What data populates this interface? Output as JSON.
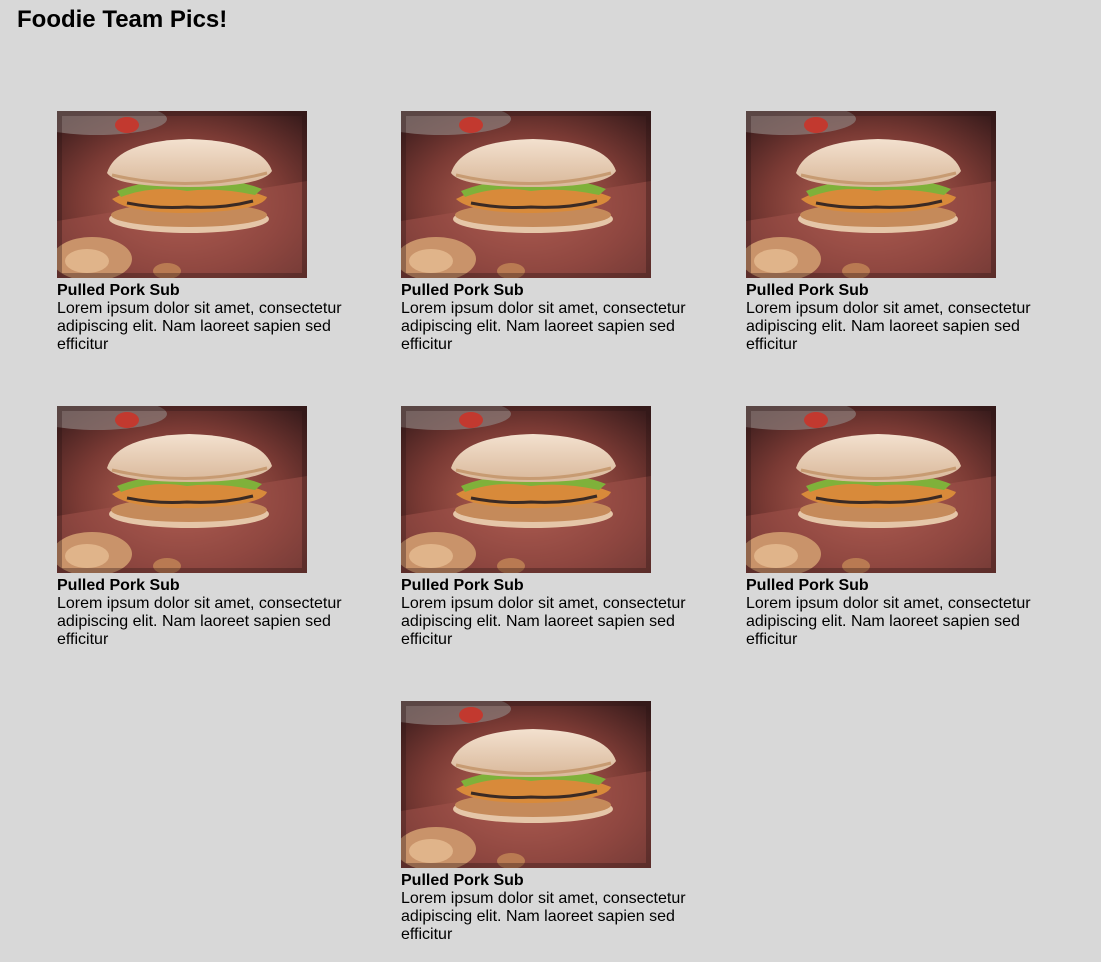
{
  "page": {
    "title": "Foodie Team Pics!"
  },
  "gallery": {
    "items": [
      {
        "title": "Pulled Pork Sub",
        "description": "Lorem ipsum dolor sit amet, consectetur adipiscing elit. Nam laoreet sapien sed efficitur",
        "image": "sandwich-photo"
      },
      {
        "title": "Pulled Pork Sub",
        "description": "Lorem ipsum dolor sit amet, consectetur adipiscing elit. Nam laoreet sapien sed efficitur",
        "image": "sandwich-photo"
      },
      {
        "title": "Pulled Pork Sub",
        "description": "Lorem ipsum dolor sit amet, consectetur adipiscing elit. Nam laoreet sapien sed efficitur",
        "image": "sandwich-photo"
      },
      {
        "title": "Pulled Pork Sub",
        "description": "Lorem ipsum dolor sit amet, consectetur adipiscing elit. Nam laoreet sapien sed efficitur",
        "image": "sandwich-photo"
      },
      {
        "title": "Pulled Pork Sub",
        "description": "Lorem ipsum dolor sit amet, consectetur adipiscing elit. Nam laoreet sapien sed efficitur",
        "image": "sandwich-photo"
      },
      {
        "title": "Pulled Pork Sub",
        "description": "Lorem ipsum dolor sit amet, consectetur adipiscing elit. Nam laoreet sapien sed efficitur",
        "image": "sandwich-photo"
      },
      {
        "title": "Pulled Pork Sub",
        "description": "Lorem ipsum dolor sit amet, consectetur adipiscing elit. Nam laoreet sapien sed efficitur",
        "image": "sandwich-photo"
      }
    ]
  },
  "colors": {
    "background": "#d8d8d8",
    "text": "#000000"
  }
}
